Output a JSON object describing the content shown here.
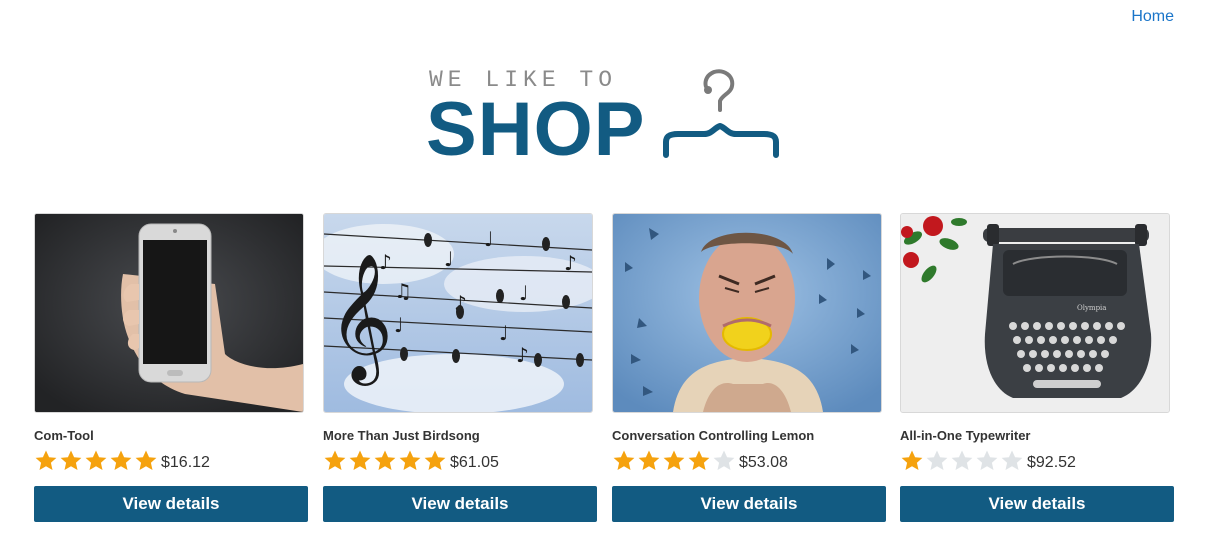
{
  "nav": {
    "home_label": "Home"
  },
  "logo": {
    "tagline": "WE LIKE TO",
    "word": "SHOP",
    "icon": "hanger-icon"
  },
  "colors": {
    "brand": "#125b82",
    "link": "#1a75c9",
    "star_on": "#f5a20e",
    "star_off": "#dfe3e6"
  },
  "products": [
    {
      "title": "Com-Tool",
      "rating": 5,
      "price": "$16.12",
      "button": "View details",
      "image": "phone-in-hand-image"
    },
    {
      "title": "More Than Just Birdsong",
      "rating": 5,
      "price": "$61.05",
      "button": "View details",
      "image": "birds-on-music-wires-image"
    },
    {
      "title": "Conversation Controlling Lemon",
      "rating": 4,
      "price": "$53.08",
      "button": "View details",
      "image": "man-biting-lemon-image"
    },
    {
      "title": "All-in-One Typewriter",
      "rating": 1,
      "price": "$92.52",
      "button": "View details",
      "image": "typewriter-image"
    }
  ]
}
